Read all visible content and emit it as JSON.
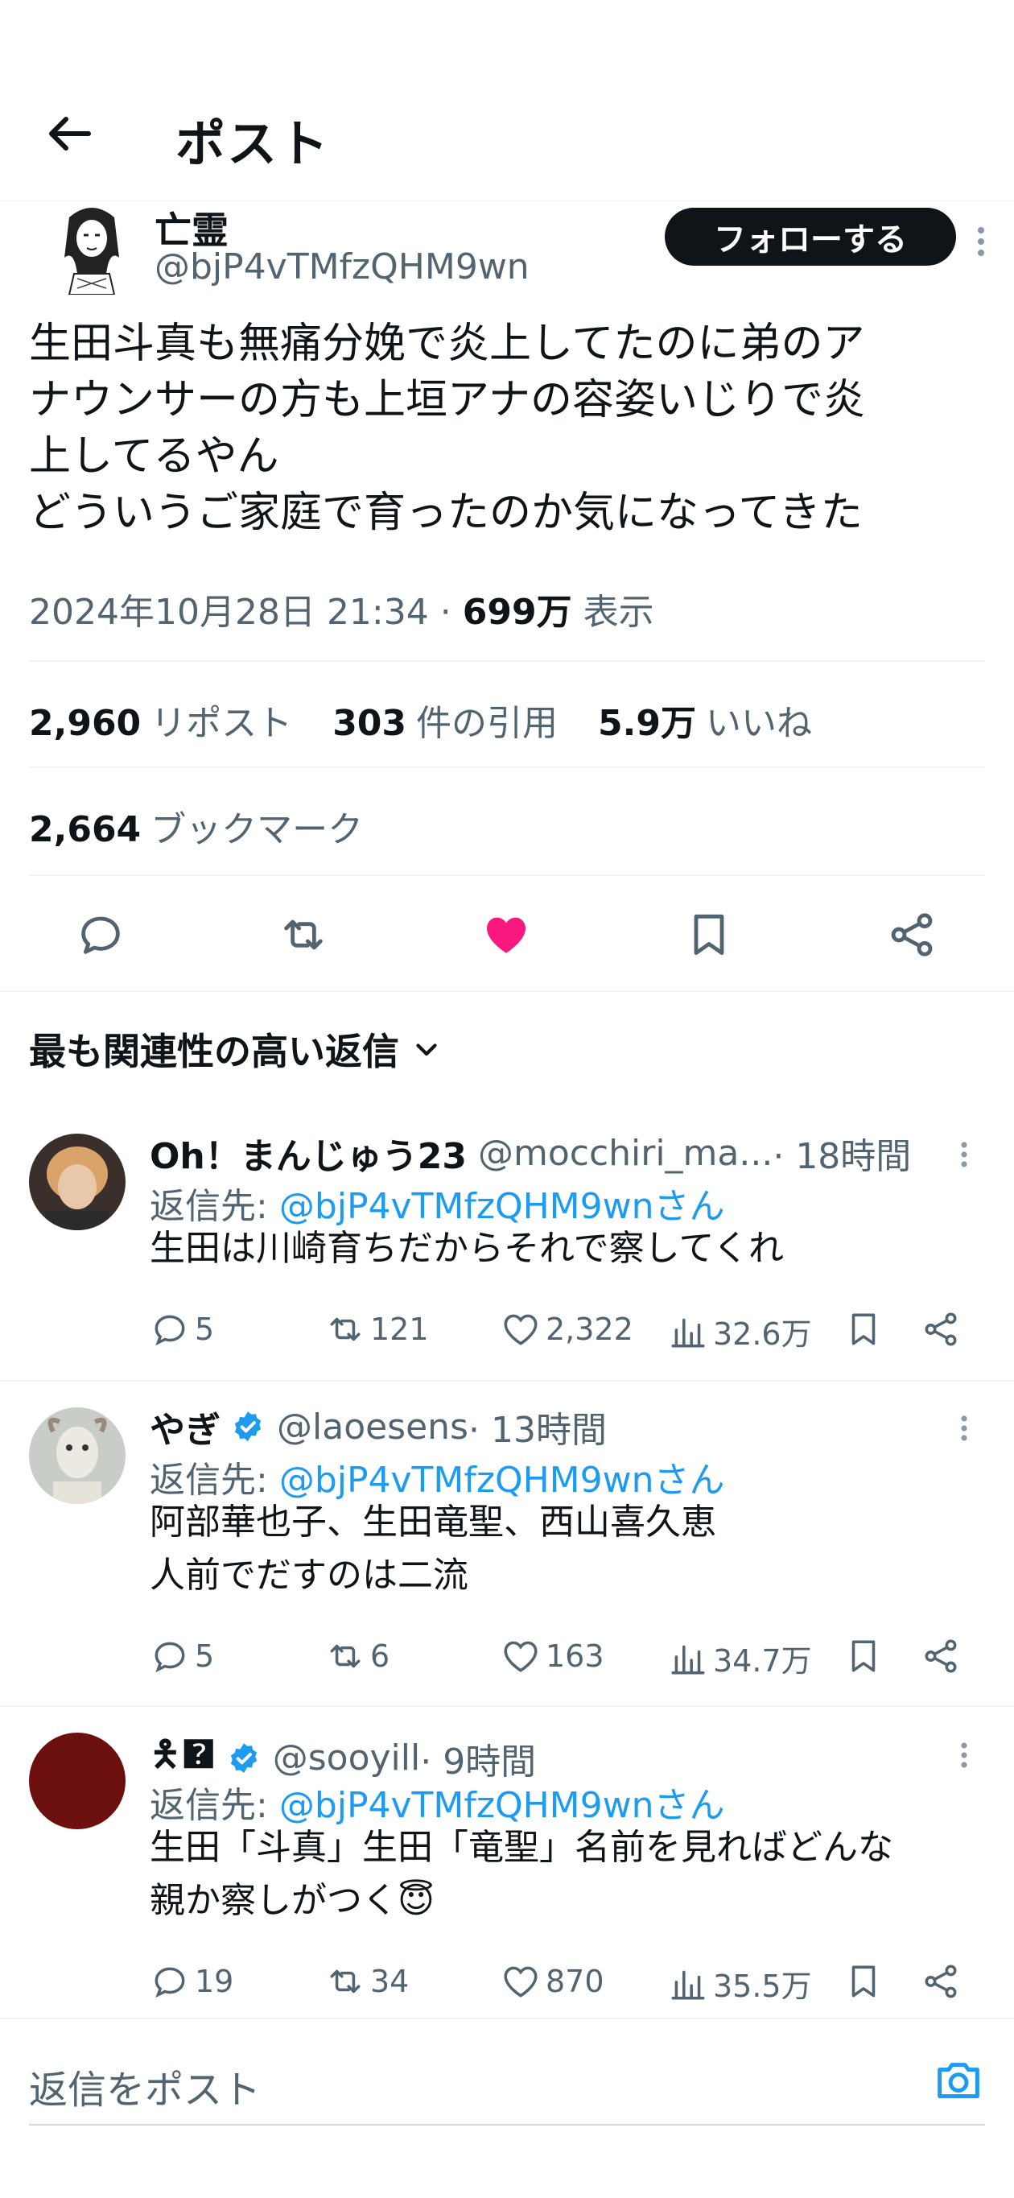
{
  "header": {
    "title": "ポスト"
  },
  "author": {
    "name": "亡霊",
    "handle": "@bjP4vTMfzQHM9wn",
    "follow_label": "フォローする"
  },
  "tweet": {
    "text": "生田斗真も無痛分娩で炎上してたのに弟のア\nナウンサーの方も上垣アナの容姿いじりで炎\n上してるやん\nどういうご家庭で育ったのか気になってきた",
    "datetime": "2024年10月28日 21:34",
    "separator": " · ",
    "views": "699万",
    "views_label": "表示"
  },
  "stats": {
    "reposts": "2,960",
    "reposts_label": "リポスト",
    "quotes": "303",
    "quotes_label": "件の引用",
    "likes": "5.9万",
    "likes_label": "いいね",
    "bookmarks": "2,664",
    "bookmarks_label": "ブックマーク"
  },
  "actions": {
    "icons": [
      "reply-icon",
      "retweet-icon",
      "heart-filled-icon",
      "bookmark-icon",
      "share-icon"
    ],
    "liked_color": "#f91880"
  },
  "replies_sort": {
    "label": "最も関連性の高い返信"
  },
  "replies": [
    {
      "name": "Oh！まんじゅう23",
      "handle": "@mocchiri_ma...",
      "time": " · 18時間",
      "verified": false,
      "reply_to_prefix": "返信先: ",
      "reply_to": "@bjP4vTMfzQHM9wnさん",
      "text": "生田は川崎育ちだからそれで察してくれ",
      "replies": "5",
      "reposts": "121",
      "likes": "2,322",
      "views": "32.6万"
    },
    {
      "name": "やぎ",
      "handle": "@laoesens",
      "time": " · 13時間",
      "verified": true,
      "reply_to_prefix": "返信先: ",
      "reply_to": "@bjP4vTMfzQHM9wnさん",
      "text": "阿部華也子、生田竜聖、西山喜久恵\n人前でだすのは二流",
      "replies": "5",
      "reposts": "6",
      "likes": "163",
      "views": "34.7万"
    },
    {
      "name": "🯅🯄",
      "handle": "@sooyill",
      "time": " · 9時間",
      "verified": true,
      "reply_to_prefix": "返信先: ",
      "reply_to": "@bjP4vTMfzQHM9wnさん",
      "text": "生田「斗真」生田「竜聖」名前を見ればどんな\n親か察しがつく😇",
      "replies": "19",
      "reposts": "34",
      "likes": "870",
      "views": "35.5万"
    }
  ],
  "compose": {
    "placeholder": "返信をポスト"
  },
  "colors": {
    "accent": "#1d9bf0",
    "text": "#0f1419",
    "muted": "#536471"
  }
}
